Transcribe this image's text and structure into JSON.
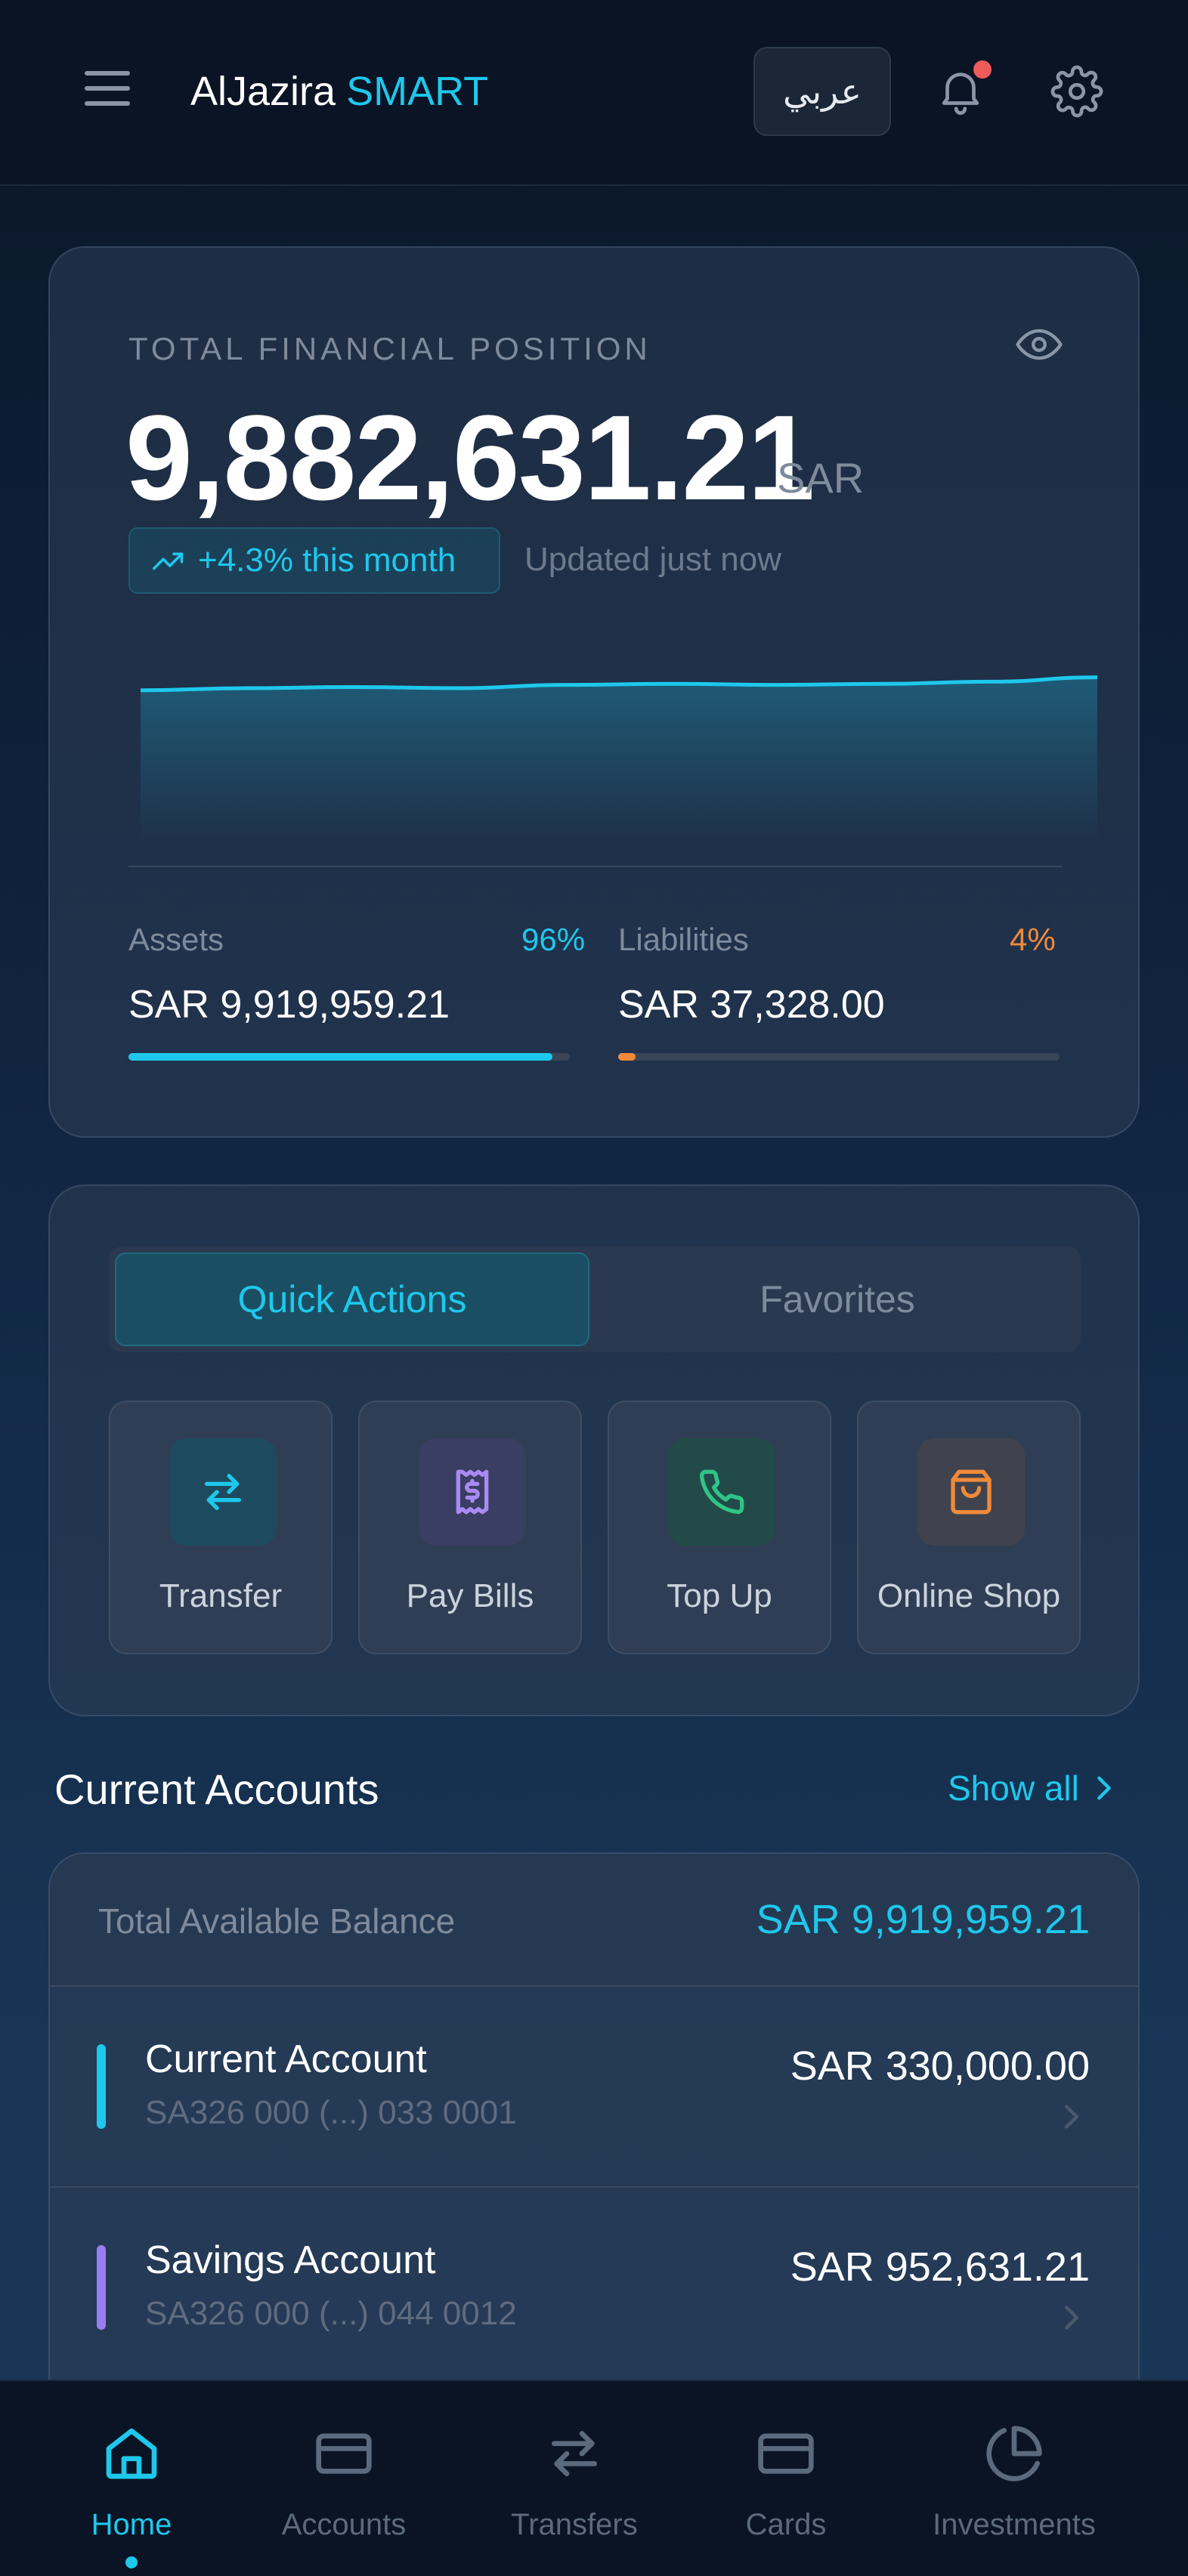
{
  "header": {
    "brand_main": "AlJazira",
    "brand_accent": "SMART",
    "language_button": "عربي",
    "has_notification": true
  },
  "financial_position": {
    "label": "TOTAL FINANCIAL POSITION",
    "value": "9,882,631.21",
    "currency": "SAR",
    "trend": "+4.3% this month",
    "updated": "Updated just now",
    "sparkline": [
      0.4,
      0.42,
      0.43,
      0.42,
      0.45,
      0.46,
      0.45,
      0.46,
      0.48,
      0.52
    ],
    "assets": {
      "label": "Assets",
      "percent_label": "96%",
      "value": "SAR 9,919,959.21",
      "fraction": 0.96
    },
    "liabilities": {
      "label": "Liabilities",
      "percent_label": "4%",
      "value": "SAR 37,328.00",
      "fraction": 0.04
    }
  },
  "quick_actions": {
    "tabs": [
      "Quick Actions",
      "Favorites"
    ],
    "active_tab": "Quick Actions",
    "items": [
      {
        "label": "Transfer",
        "icon": "transfer-arrows-icon"
      },
      {
        "label": "Pay Bills",
        "icon": "receipt-dollar-icon"
      },
      {
        "label": "Top Up",
        "icon": "phone-icon"
      },
      {
        "label": "Online Shop",
        "icon": "shopping-bag-icon"
      }
    ]
  },
  "accounts": {
    "title": "Current Accounts",
    "show_all": "Show all",
    "total_label": "Total Available Balance",
    "total_value": "SAR 9,919,959.21",
    "items": [
      {
        "name": "Current Account",
        "iban": "SA326 000 (...) 033 0001",
        "balance": "SAR 330,000.00",
        "color": "#1ec8ec"
      },
      {
        "name": "Savings Account",
        "iban": "SA326 000 (...) 044 0012",
        "balance": "SAR 952,631.21",
        "color": "#9b7cf0"
      }
    ]
  },
  "bottom_nav": {
    "items": [
      "Home",
      "Accounts",
      "Transfers",
      "Cards",
      "Investments"
    ],
    "active": "Home"
  },
  "colors": {
    "accent": "#1ec8ec",
    "liabilities": "#f08a3a",
    "notification": "#ef5a5a"
  }
}
